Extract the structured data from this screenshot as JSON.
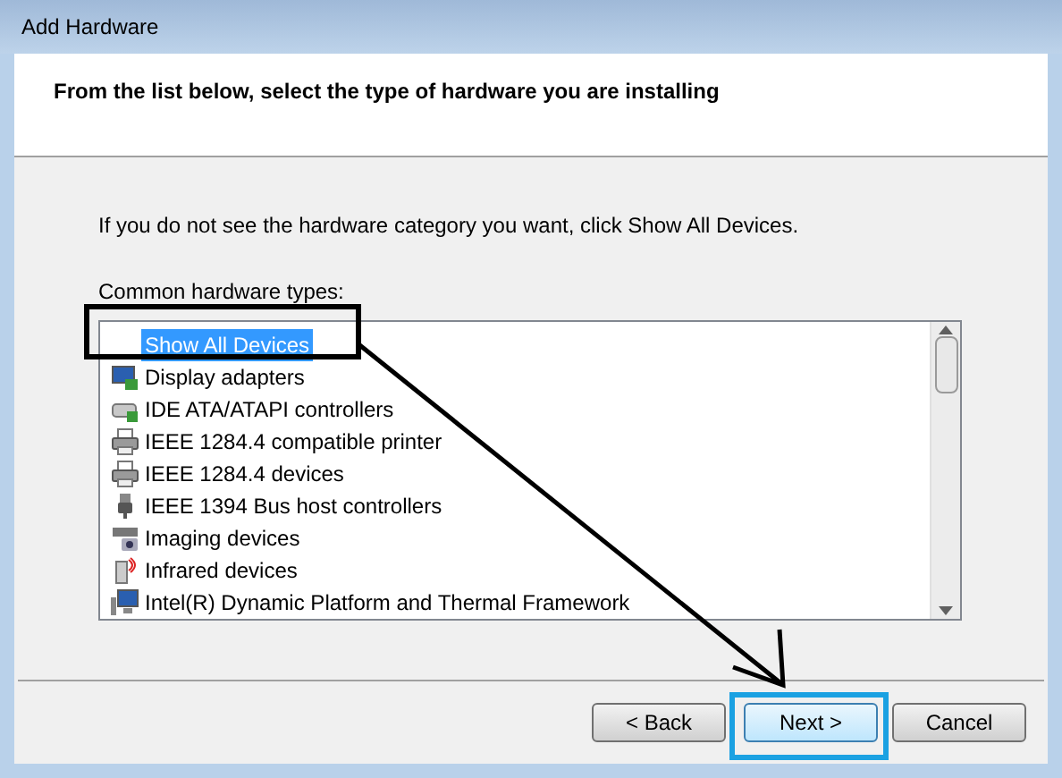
{
  "window": {
    "title": "Add Hardware"
  },
  "header": {
    "heading": "From the list below, select the type of hardware you are installing"
  },
  "instruction": "If you do not see the hardware category you want, click Show All Devices.",
  "list_label": "Common hardware types:",
  "items": [
    {
      "label": "Show All Devices",
      "kind": "none",
      "selected": true
    },
    {
      "label": "Display adapters",
      "kind": "display",
      "selected": false
    },
    {
      "label": "IDE ATA/ATAPI controllers",
      "kind": "drive",
      "selected": false
    },
    {
      "label": "IEEE 1284.4 compatible printer",
      "kind": "printer",
      "selected": false
    },
    {
      "label": "IEEE 1284.4 devices",
      "kind": "printer",
      "selected": false
    },
    {
      "label": "IEEE 1394 Bus host controllers",
      "kind": "plug",
      "selected": false
    },
    {
      "label": "Imaging devices",
      "kind": "camera",
      "selected": false
    },
    {
      "label": "Infrared devices",
      "kind": "infrared",
      "selected": false
    },
    {
      "label": "Intel(R) Dynamic Platform and Thermal Framework",
      "kind": "computer",
      "selected": false
    }
  ],
  "buttons": [
    {
      "label": "< Back",
      "kind": "normal"
    },
    {
      "label": "Next >",
      "kind": "default"
    },
    {
      "label": "Cancel",
      "kind": "normal"
    }
  ]
}
